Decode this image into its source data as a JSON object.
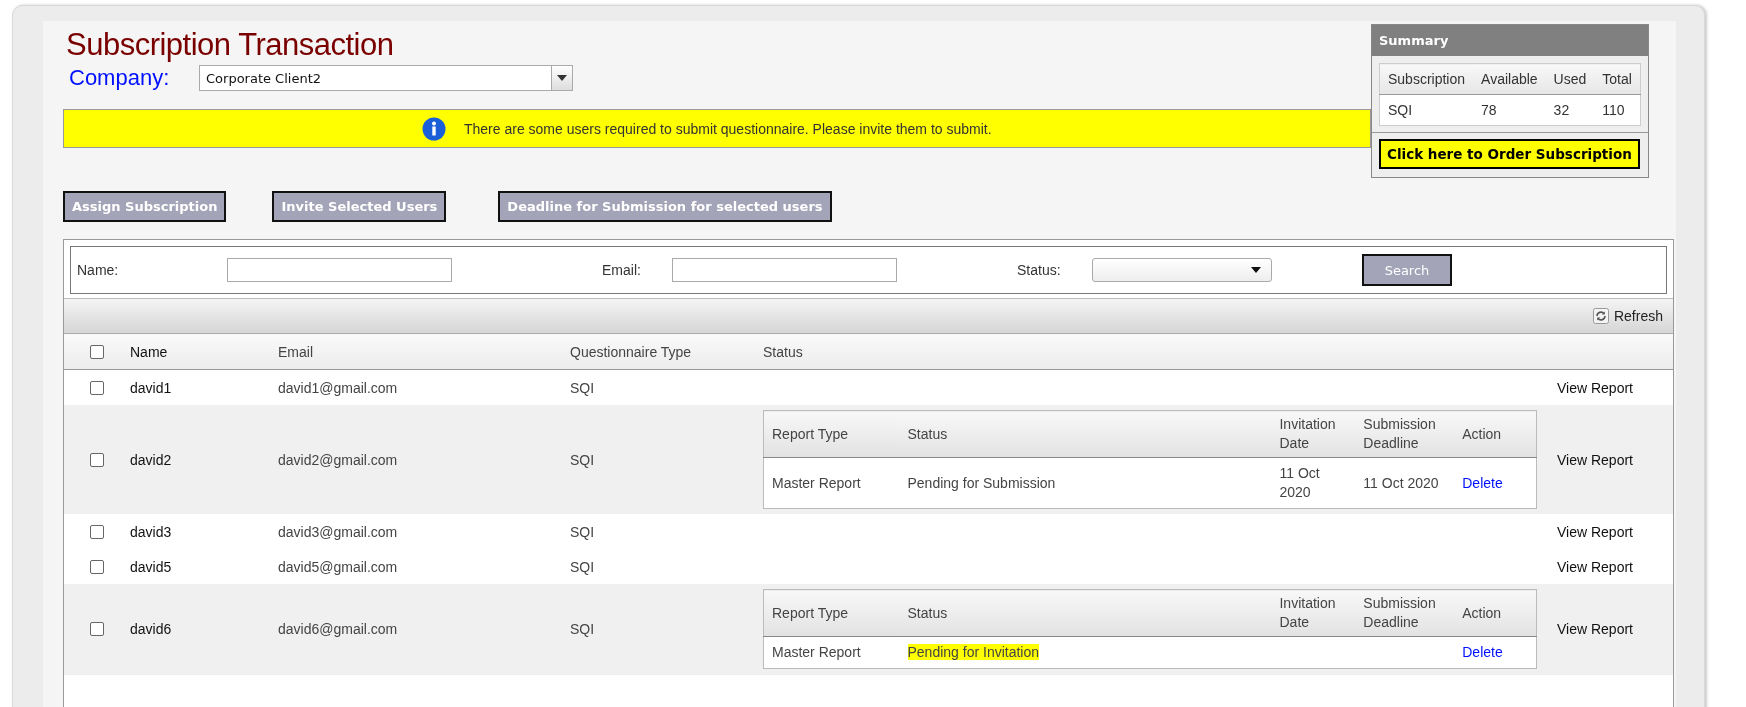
{
  "title": "Subscription Transaction",
  "company": {
    "label": "Company:",
    "value": "Corporate Client2"
  },
  "notice": "There are some users required to submit questionnaire. Please invite them to submit.",
  "summary": {
    "title": "Summary",
    "columns": [
      "Subscription",
      "Available",
      "Used",
      "Total"
    ],
    "rows": [
      [
        "SQI",
        "78",
        "32",
        "110"
      ]
    ],
    "order_button": "Click here to Order Subscription"
  },
  "actions": [
    "Assign Subscription",
    "Invite Selected Users",
    "Deadline for Submission for selected users"
  ],
  "filters": {
    "name_label": "Name:",
    "email_label": "Email:",
    "status_label": "Status:",
    "search_button": "Search"
  },
  "refresh": "Refresh",
  "table": {
    "columns": [
      "Name",
      "Email",
      "Questionnaire Type",
      "Status"
    ],
    "select_all_checked": false,
    "rows": [
      {
        "name": "david1",
        "email": "david1@gmail.com",
        "type": "SQI",
        "checked": false,
        "link": "View Report"
      },
      {
        "name": "david2",
        "email": "david2@gmail.com",
        "type": "SQI",
        "checked": false,
        "link": "View Report",
        "report_columns": [
          "Report Type",
          "Status",
          "Invitation Date",
          "Submission Deadline",
          "Action"
        ],
        "reports": [
          {
            "report_type": "Master Report",
            "status": "Pending for Submission",
            "highlighted": false,
            "invitation_date": "11 Oct 2020",
            "deadline": "11 Oct 2020",
            "action": "Delete"
          }
        ]
      },
      {
        "name": "david3",
        "email": "david3@gmail.com",
        "type": "SQI",
        "checked": false,
        "link": "View Report"
      },
      {
        "name": "david5",
        "email": "david5@gmail.com",
        "type": "SQI",
        "checked": false,
        "link": "View Report"
      },
      {
        "name": "david6",
        "email": "david6@gmail.com",
        "type": "SQI",
        "checked": false,
        "link": "View Report",
        "report_columns": [
          "Report Type",
          "Status",
          "Invitation Date",
          "Submission Deadline",
          "Action"
        ],
        "reports": [
          {
            "report_type": "Master Report",
            "status": "Pending for Invitation",
            "highlighted": true,
            "action": "Delete"
          }
        ]
      }
    ]
  }
}
